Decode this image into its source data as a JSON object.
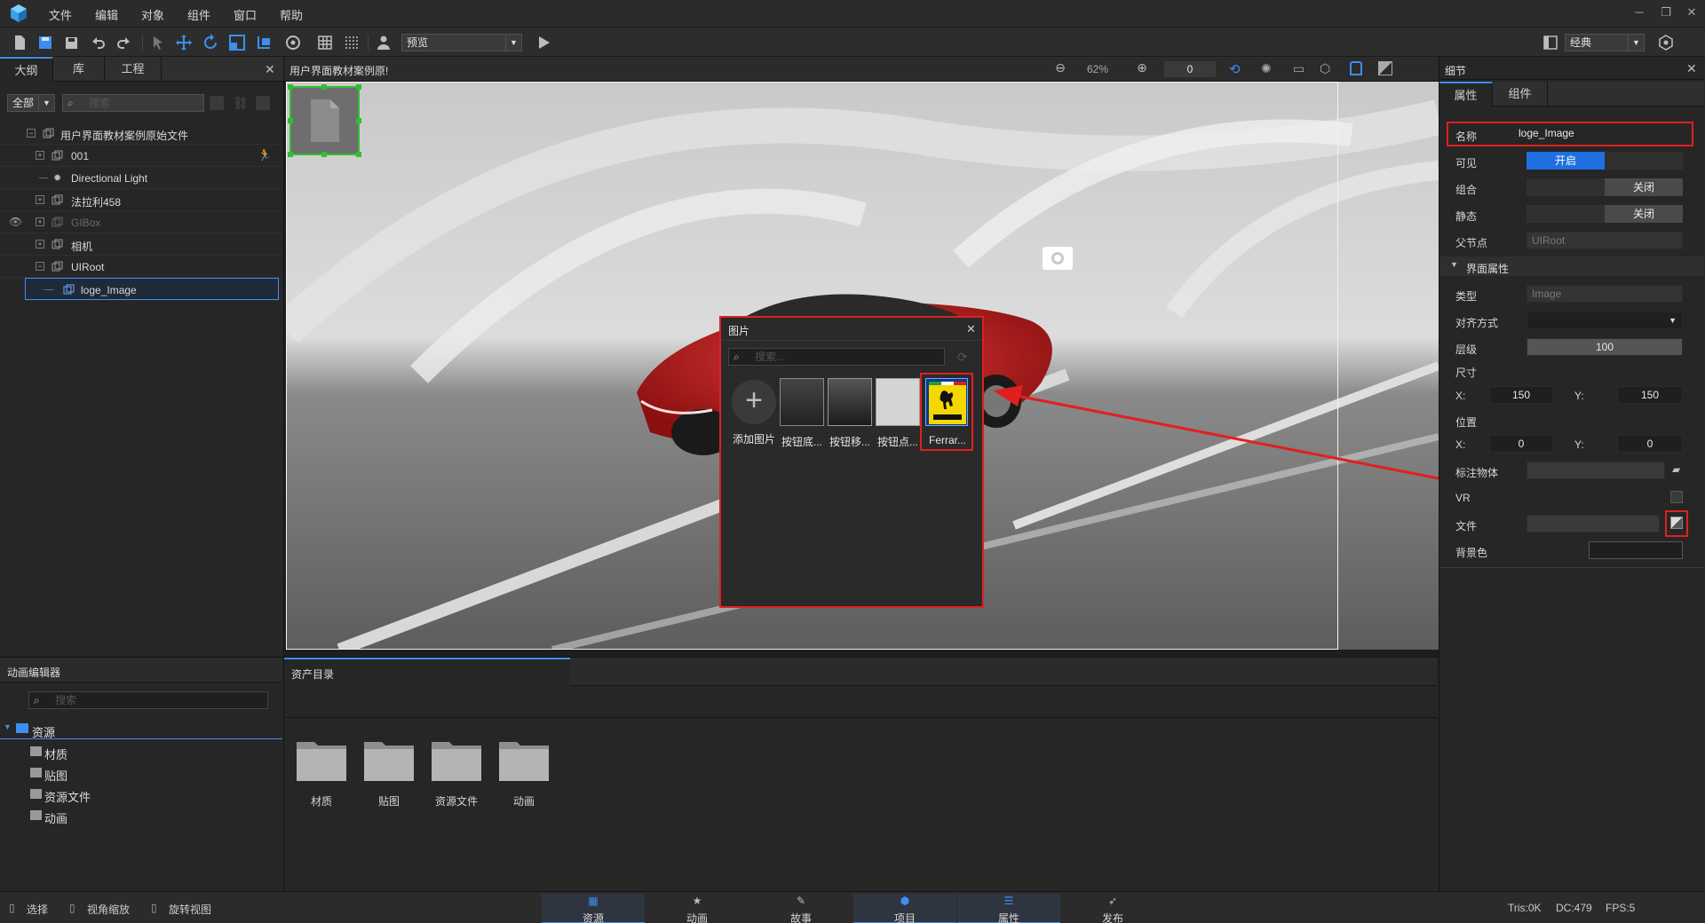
{
  "menu": {
    "items": [
      "文件",
      "编辑",
      "对象",
      "组件",
      "窗口",
      "帮助"
    ]
  },
  "toolbar": {
    "preview_select": "预览",
    "layout_select": "经典"
  },
  "outline": {
    "tabs": [
      "大纲",
      "库",
      "工程"
    ],
    "filter": "全部",
    "search_placeholder": "搜索",
    "tree": [
      {
        "label": "用户界面教材案例原始文件",
        "level": 0,
        "expanded": true
      },
      {
        "label": "001",
        "level": 1
      },
      {
        "label": "Directional Light",
        "level": 1
      },
      {
        "label": "法拉利458",
        "level": 1
      },
      {
        "label": "GIBox",
        "level": 1,
        "dim": true
      },
      {
        "label": "相机",
        "level": 1
      },
      {
        "label": "UIRoot",
        "level": 1,
        "expanded": true
      },
      {
        "label": "loge_Image",
        "level": 2,
        "selected": true
      }
    ]
  },
  "viewport": {
    "title": "用户界面教材案例原!",
    "zoom": "62%",
    "value_field": "0"
  },
  "image_dialog": {
    "title": "图片",
    "search_placeholder": "搜索...",
    "items": [
      "添加图片",
      "按钮底...",
      "按钮移...",
      "按钮点...",
      "Ferrar..."
    ]
  },
  "details": {
    "title": "细节",
    "tabs": [
      "属性",
      "组件"
    ],
    "name_label": "名称",
    "name_value": "loge_Image",
    "visible_label": "可见",
    "visible_on": "开启",
    "group_label": "组合",
    "group_off": "关闭",
    "static_label": "静态",
    "static_off": "关闭",
    "parent_label": "父节点",
    "parent_value": "UIRoot",
    "section_title": "界面属性",
    "type_label": "类型",
    "type_value": "Image",
    "align_label": "对齐方式",
    "layer_label": "层级",
    "layer_value": "100",
    "size_label": "尺寸",
    "size_x_label": "X:",
    "size_x": "150",
    "size_y_label": "Y:",
    "size_y": "150",
    "pos_label": "位置",
    "pos_x_label": "X:",
    "pos_x": "0",
    "pos_y_label": "Y:",
    "pos_y": "0",
    "annot_label": "标注物体",
    "vr_label": "VR",
    "file_label": "文件",
    "bg_label": "背景色"
  },
  "anim_editor": {
    "title": "动画编辑器",
    "search_placeholder": "搜索",
    "root": "资源",
    "children": [
      "材质",
      "贴图",
      "资源文件",
      "动画"
    ]
  },
  "assets": {
    "tab": "资产目录",
    "folders": [
      "材质",
      "贴图",
      "资源文件",
      "动画"
    ]
  },
  "status": {
    "hints": [
      "选择",
      "视角缩放",
      "旋转视图"
    ],
    "tabs": [
      "资源",
      "动画",
      "故事",
      "项目",
      "属性",
      "发布"
    ],
    "tris": "Tris:0K",
    "dc": "DC:479",
    "fps": "FPS:5"
  },
  "colors": {
    "accent": "#3d8ef0",
    "highlight_red": "#e02020",
    "selection_green": "#2fbf2f"
  }
}
